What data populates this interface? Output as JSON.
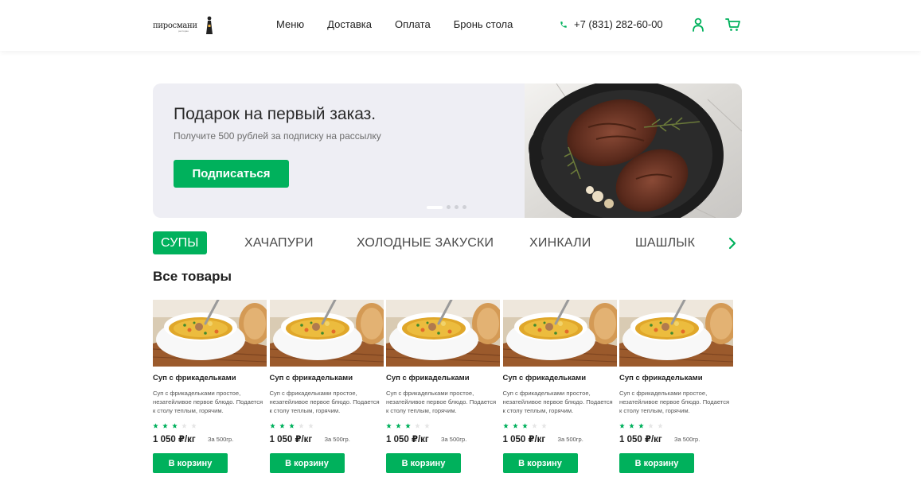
{
  "header": {
    "logo_text": "пиросмани",
    "logo_sub": "ресторан",
    "nav": [
      "Меню",
      "Доставка",
      "Оплата",
      "Бронь стола"
    ],
    "phone": "+7 (831) 282-60-00",
    "icons": [
      "phone-icon",
      "user-icon",
      "cart-icon"
    ],
    "accent_color": "#00b15c"
  },
  "banner": {
    "title": "Подарок на первый заказ.",
    "subtitle": "Получите 500 рублей за подписку на рассылку",
    "button": "Подписаться",
    "slides_total": 4,
    "active_slide": 1
  },
  "categories": {
    "items": [
      "СУПЫ",
      "ХАЧАПУРИ",
      "ХОЛОДНЫЕ ЗАКУСКИ",
      "ХИНКАЛИ",
      "ШАШЛЫК"
    ],
    "active": "СУПЫ"
  },
  "products": {
    "title": "Все товары",
    "items": [
      {
        "name": "Суп с фрикадельками",
        "description": "Суп с фрикадельками простое, незатейливое первое блюдо. Подается к столу теплым, горячим.",
        "rating": 3,
        "rating_max": 5,
        "price": "1 050 ₽/кг",
        "weight": "За 500гр.",
        "button": "В корзину"
      },
      {
        "name": "Суп с фрикадельками",
        "description": "Суп с фрикадельками простое, незатейливое первое блюдо. Подается к столу теплым, горячим.",
        "rating": 3,
        "rating_max": 5,
        "price": "1 050 ₽/кг",
        "weight": "За 500гр.",
        "button": "В корзину"
      },
      {
        "name": "Суп с фрикадельками",
        "description": "Суп с фрикадельками простое, незатейливое первое блюдо. Подается к столу теплым, горячим.",
        "rating": 3,
        "rating_max": 5,
        "price": "1 050 ₽/кг",
        "weight": "За 500гр.",
        "button": "В корзину"
      },
      {
        "name": "Суп с фрикадельками",
        "description": "Суп с фрикадельками простое, незатейливое первое блюдо. Подается к столу теплым, горячим.",
        "rating": 3,
        "rating_max": 5,
        "price": "1 050 ₽/кг",
        "weight": "За 500гр.",
        "button": "В корзину"
      },
      {
        "name": "Суп с фрикадельками",
        "description": "Суп с фрикадельками простое, незатейливое первое блюдо. Подается к столу теплым, горячим.",
        "rating": 3,
        "rating_max": 5,
        "price": "1 050 ₽/кг",
        "weight": "За 500гр.",
        "button": "В корзину"
      }
    ]
  }
}
